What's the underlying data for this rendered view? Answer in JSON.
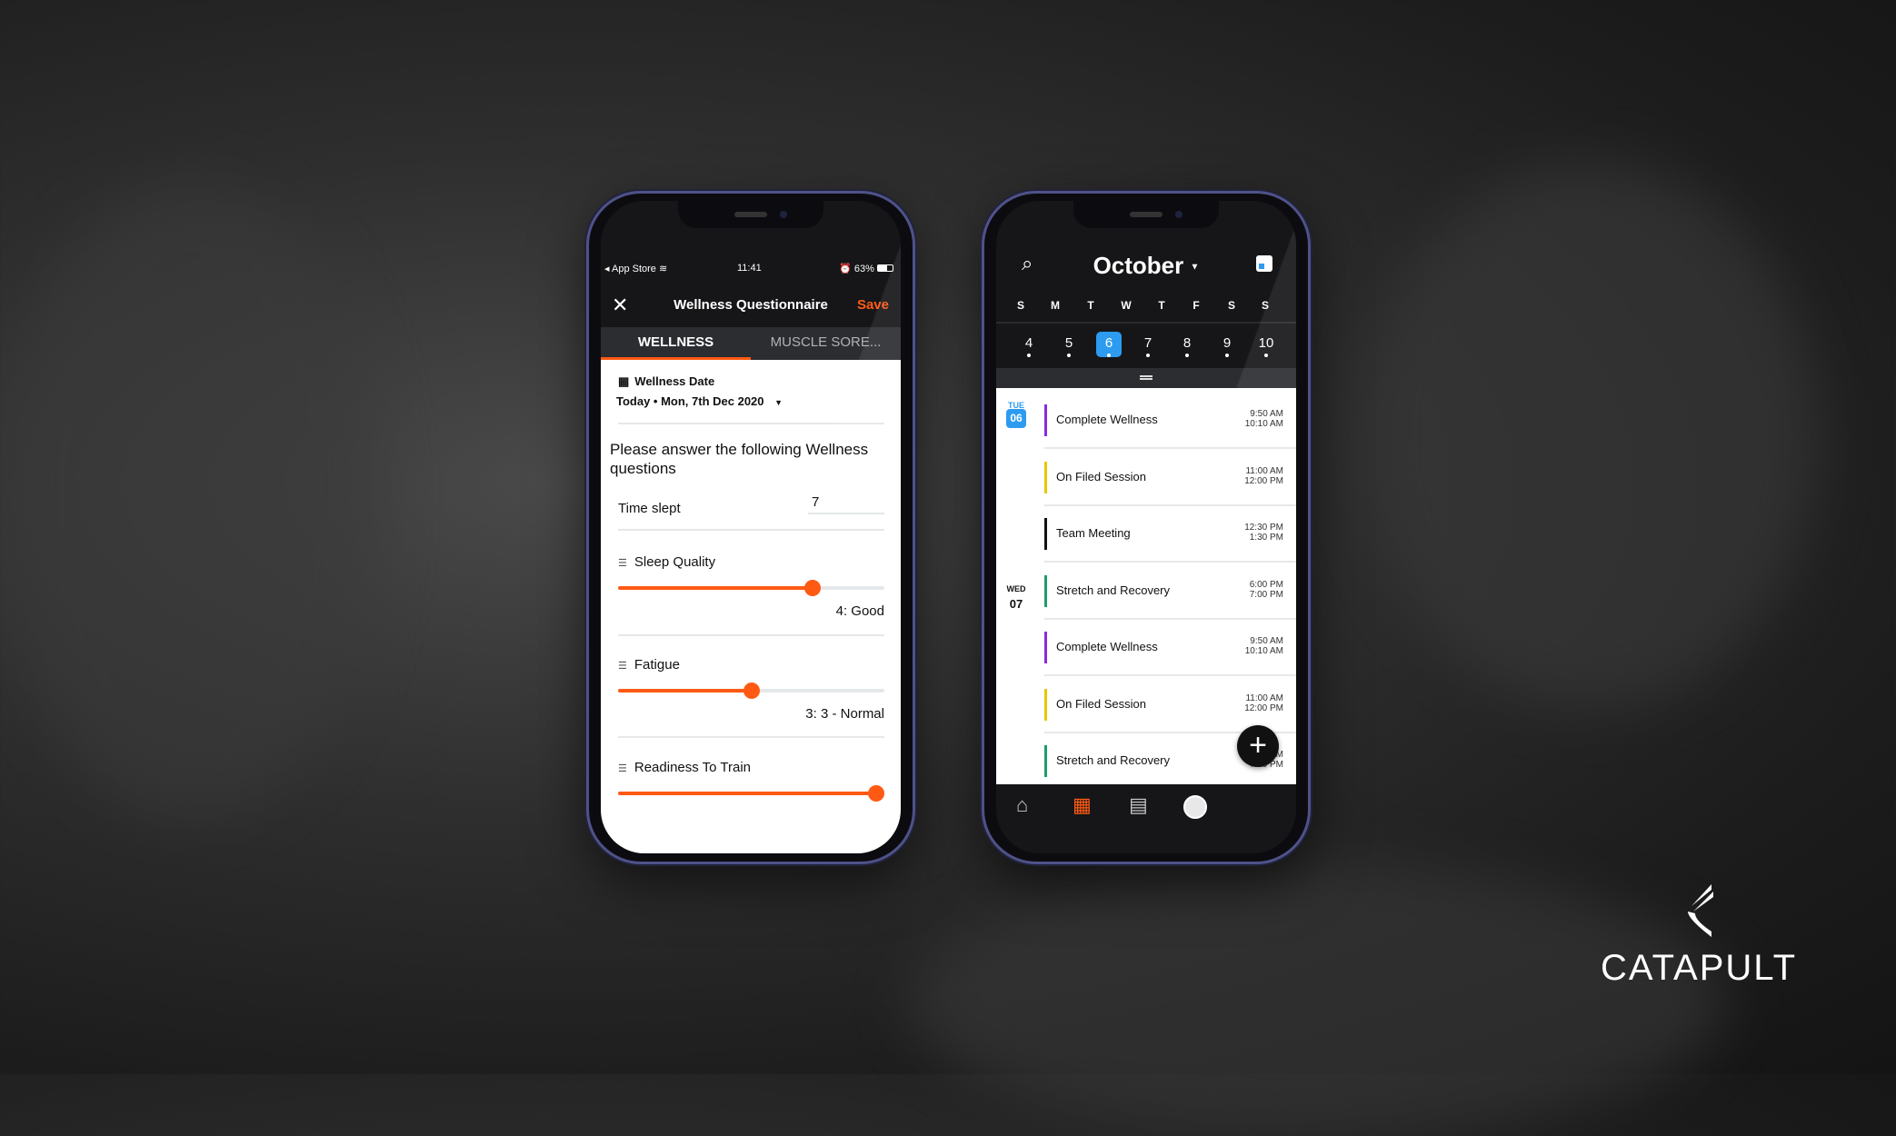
{
  "brand": {
    "name": "CATAPULT"
  },
  "wellness_phone": {
    "status": {
      "back_app": "App Store",
      "time": "11:41",
      "battery": "63%"
    },
    "title": "Wellness Questionnaire",
    "save_label": "Save",
    "close_icon": "close-icon",
    "tabs": [
      {
        "label": "WELLNESS",
        "active": true
      },
      {
        "label": "MUSCLE SORE...",
        "active": false
      }
    ],
    "date_label": "Wellness Date",
    "date_value": "Today • Mon, 7th Dec 2020",
    "intro": "Please answer the following Wellness questions",
    "time_slept": {
      "label": "Time slept",
      "value": "7"
    },
    "sliders": [
      {
        "label": "Sleep Quality",
        "value_text": "4: Good",
        "fraction": 0.73
      },
      {
        "label": "Fatigue",
        "value_text": "3: 3 - Normal",
        "fraction": 0.5
      },
      {
        "label": "Readiness To Train",
        "value_text": "",
        "fraction": 0.97
      }
    ],
    "accent": "#ff5a14"
  },
  "calendar_phone": {
    "month": "October",
    "weekdays": [
      "S",
      "M",
      "T",
      "W",
      "T",
      "F",
      "S",
      "S"
    ],
    "dates": [
      "4",
      "5",
      "6",
      "7",
      "8",
      "9",
      "10"
    ],
    "selected_date": "6",
    "days": [
      {
        "dow": "TUE",
        "day": "06",
        "selected": true
      },
      {
        "dow": "WED",
        "day": "07",
        "selected": false
      }
    ],
    "events": [
      {
        "title": "Complete Wellness",
        "start": "9:50 AM",
        "end": "10:10 AM",
        "color": "#8a2be2"
      },
      {
        "title": "On Filed Session",
        "start": "11:00 AM",
        "end": "12:00 PM",
        "color": "#e6c800"
      },
      {
        "title": "Team Meeting",
        "start": "12:30 PM",
        "end": "1:30 PM",
        "color": "#111111"
      },
      {
        "title": "Stretch and Recovery",
        "start": "6:00 PM",
        "end": "7:00 PM",
        "color": "#1e9c6a"
      },
      {
        "title": "Complete Wellness",
        "start": "9:50 AM",
        "end": "10:10 AM",
        "color": "#8a2be2"
      },
      {
        "title": "On Filed Session",
        "start": "11:00 AM",
        "end": "12:00 PM",
        "color": "#e6c800"
      },
      {
        "title": "Stretch and Recovery",
        "start": "6:00 PM",
        "end": "7:00 PM",
        "color": "#1e9c6a"
      }
    ],
    "nav": [
      "home-icon",
      "calendar-icon",
      "document-icon",
      "profile-avatar"
    ],
    "selected_color": "#2d9bf0"
  }
}
